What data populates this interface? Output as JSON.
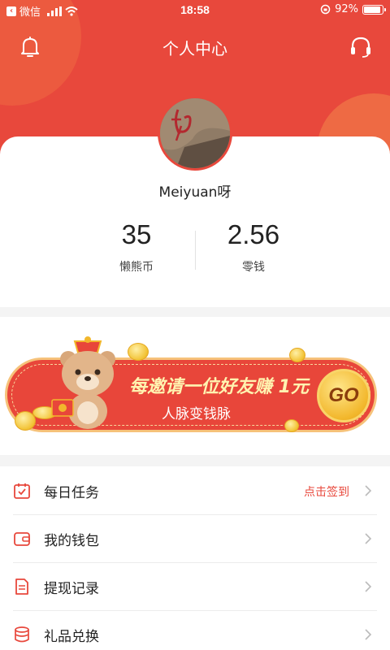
{
  "status_bar": {
    "back_app": "微信",
    "time": "18:58",
    "battery": "92%",
    "battery_level": 0.92
  },
  "header": {
    "title": "个人中心"
  },
  "profile": {
    "username": "Meiyuan呀",
    "stats": [
      {
        "value": "35",
        "label": "懒熊币"
      },
      {
        "value": "2.56",
        "label": "零钱"
      }
    ]
  },
  "banner": {
    "title": "每邀请一位好友赚 1元",
    "subtitle": "人脉变钱脉",
    "button": "GO"
  },
  "menu": [
    {
      "label": "每日任务",
      "extra": "点击签到",
      "icon": "calendar-check-icon"
    },
    {
      "label": "我的钱包",
      "extra": "",
      "icon": "wallet-icon"
    },
    {
      "label": "提现记录",
      "extra": "",
      "icon": "document-icon"
    },
    {
      "label": "礼品兑换",
      "extra": "",
      "icon": "coin-stack-icon"
    }
  ],
  "colors": {
    "primary": "#e8483c",
    "gold": "#f2b72c"
  }
}
